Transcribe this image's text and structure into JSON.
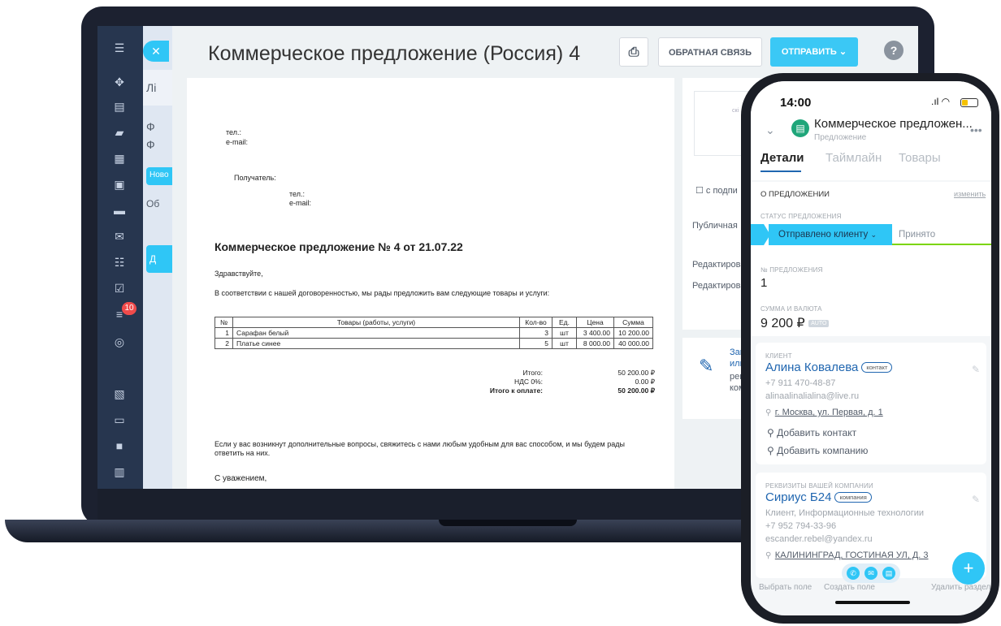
{
  "laptop": {
    "rail_badge": "10",
    "crm_strip_1": "Лі",
    "crm_strip_2": "Ф",
    "crm_strip_3": "Ф",
    "crm_blue_1": "Ново",
    "crm_strip_4": "Об",
    "crm_blue_2": "Д"
  },
  "panel": {
    "title": "Коммерческое предложение (Россия) 4",
    "feedback_label": "ОБРАТНАЯ СВЯЗЬ",
    "send_label": "ОТПРАВИТЬ"
  },
  "document": {
    "tel_label": "тел.:",
    "email_label": "e-mail:",
    "recipient_label": "Получатель:",
    "recipient_tel": "тел.:",
    "recipient_email": "e-mail:",
    "heading": "Коммерческое предложение № 4 от 21.07.22",
    "greeting": "Здравствуйте,",
    "intro": "В соответствии с нашей договоренностью, мы рады предложить вам следующие товары и услуги:",
    "table": {
      "headers": [
        "№",
        "Товары (работы, услуги)",
        "Кол-во",
        "Ед.",
        "Цена",
        "Сумма"
      ],
      "rows": [
        [
          "1",
          "Сарафан белый",
          "3",
          "шт",
          "3 400.00",
          "10 200.00"
        ],
        [
          "2",
          "Платье синее",
          "5",
          "шт",
          "8 000.00",
          "40 000.00"
        ]
      ]
    },
    "totals": {
      "subtotal_label": "Итого:",
      "subtotal_value": "50 200.00 ₽",
      "vat_label": "НДС 0%:",
      "vat_value": "0.00 ₽",
      "total_label": "Итого к оплате:",
      "total_value": "50 200.00 ₽"
    },
    "closing": "Если у вас возникнут дополнительные вопросы, свяжитесь с нами любым удобным для вас способом, и мы будем рады ответить на них.",
    "closing_line2": "будем рады ответить на них.",
    "regards": "С уважением,"
  },
  "side": {
    "sign_fragment": "скі",
    "checkbox_label": "с подпи",
    "public_label": "Публичная",
    "edit_1": "Редактирова",
    "edit_2": "Редактирова",
    "card_line1": "Зап",
    "card_line2": "или",
    "card_line3": "рек",
    "card_line4": "ком"
  },
  "phone": {
    "time": "14:00",
    "header_title": "Коммерческое предложен...",
    "header_subtitle": "Предложение",
    "tabs": [
      "Детали",
      "Таймлайн",
      "Товары"
    ],
    "section_title": "О ПРЕДЛОЖЕНИИ",
    "edit_link": "изменить",
    "status_label": "СТАТУС ПРЕДЛОЖЕНИЯ",
    "status_current": "Отправлено клиенту",
    "status_next": "Принято",
    "number_label": "№ ПРЕДЛОЖЕНИЯ",
    "number_value": "1",
    "amount_label": "СУММА И ВАЛЮТА",
    "amount_value": "9 200 ₽",
    "amount_badge": "AUTO",
    "client_label": "КЛИЕНТ",
    "client_name": "Алина Ковалева",
    "client_chip": "контакт",
    "client_phone": "+7 911 470-48-87",
    "client_email": "alinaalinalialina@live.ru",
    "client_address": "г. Москва, ул. Первая, д. 1",
    "add_contact": "Добавить контакт",
    "add_company": "Добавить компанию",
    "company_label": "РЕКВИЗИТЫ ВАШЕЙ КОМПАНИИ",
    "company_name": "Сириус Б24",
    "company_chip": "компания",
    "company_desc": "Клиент, Информационные технологии",
    "company_phone": "+7 952 794-33-96",
    "company_email": "escander.rebel@yandex.ru",
    "company_address": "КАЛИНИНГРАД, ГОСТИНАЯ УЛ, Д. 3",
    "footer_select": "Выбрать поле",
    "footer_create": "Создать поле",
    "footer_delete": "Удалить раздел"
  }
}
